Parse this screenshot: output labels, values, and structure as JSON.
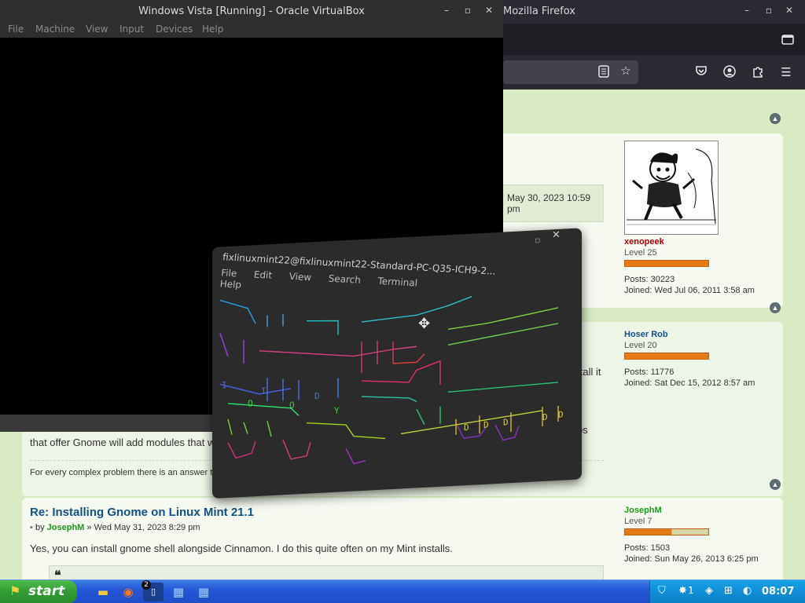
{
  "firefox": {
    "title": "Mozilla Firefox",
    "window_controls": {
      "minimize": "–",
      "maximize": "▫",
      "close": "✕"
    }
  },
  "vbox": {
    "title": "Windows Vista [Running] - Oracle VirtualBox",
    "menu": [
      "File",
      "Machine",
      "View",
      "Input",
      "Devices",
      "Help"
    ],
    "window_controls": {
      "minimize": "–",
      "maximize": "▫",
      "close": "✕"
    }
  },
  "forum": {
    "post1": {
      "date_fragment": "May 30, 2023 10:59 pm",
      "author": {
        "name": "xenopeek",
        "level": "Level 25",
        "posts_label": "Posts:",
        "posts": "30223",
        "joined_label": "Joined:",
        "joined": "Wed Jul 06, 2011 3:58 am"
      }
    },
    "post2": {
      "install_fragment": "nstall it",
      "body_fragment": "that offer Gnome will add modules that w",
      "os_fragment": "os",
      "signature": "For every complex problem there is an answer tha",
      "author": {
        "name": "Hoser Rob",
        "level": "Level 20",
        "posts_label": "Posts:",
        "posts": "11776",
        "joined_label": "Joined:",
        "joined": "Sat Dec 15, 2012 8:57 am"
      }
    },
    "post3": {
      "title": "Re: Installing Gnome on Linux Mint 21.1",
      "by": "by",
      "author_link": "JosephM",
      "date": "» Wed May 31, 2023 8:29 pm",
      "body": "Yes, you can install gnome shell alongside Cinnamon. I do this quite often on my Mint installs.",
      "quote_mark": "❝",
      "author": {
        "name": "JosephM",
        "level": "Level 7",
        "posts_label": "Posts:",
        "posts": "1503",
        "joined_label": "Joined:",
        "joined": "Sun May 26, 2013 6:25 pm"
      }
    }
  },
  "terminal": {
    "title": "fixlinuxmint22@fixlinuxmint22-Standard-PC-Q35-ICH9-2...",
    "menu": [
      "File",
      "Edit",
      "View",
      "Search",
      "Terminal",
      "Help"
    ],
    "close": "✕",
    "maximize": "▫"
  },
  "taskbar": {
    "start_label": "start",
    "badge": "2",
    "tray_count": "1",
    "clock": "08:07"
  },
  "colors": {
    "taskbar_blue": "#2457d6",
    "start_green": "#2f9a2f",
    "tray_blue": "#0f8ed6",
    "forum_bg": "#d8ebc4",
    "username_red": "#b00000",
    "username_blue": "#105289",
    "username_green": "#1e9a1e"
  }
}
